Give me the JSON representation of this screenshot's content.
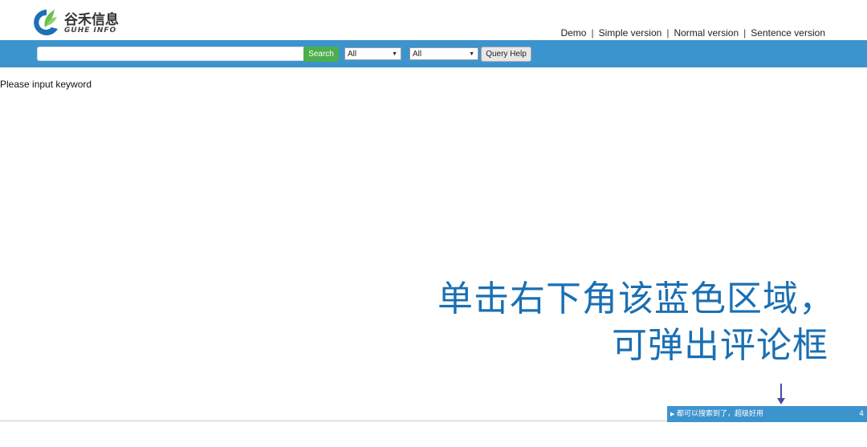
{
  "logo": {
    "name_zh": "谷禾信息",
    "name_en": "GUHE INFO"
  },
  "nav_links": [
    {
      "label": "Demo"
    },
    {
      "label": "Simple version"
    },
    {
      "label": "Normal version"
    },
    {
      "label": "Sentence version"
    }
  ],
  "nav_separator": "|",
  "search": {
    "keyword_value": "",
    "search_label": "Search",
    "filter1_selected": "All",
    "filter2_selected": "All",
    "help_label": "Query Help"
  },
  "main": {
    "prompt": "Please input keyword"
  },
  "annotation": {
    "line1": "单击右下角该蓝色区域，",
    "line2": "可弹出评论框"
  },
  "comment_bar": {
    "message": "都可以搜索到了，超级好用",
    "count": "4"
  },
  "colors": {
    "accent": "#3c94cf",
    "search_button": "#4cae4c",
    "annotation": "#1a6fb3"
  }
}
